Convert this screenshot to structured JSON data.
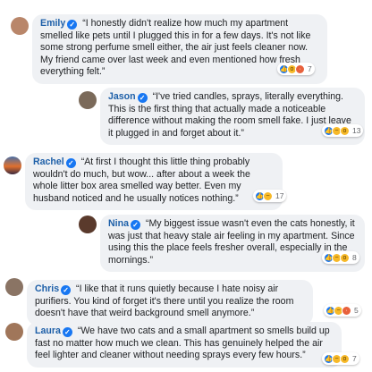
{
  "comments": [
    {
      "author": "Emily",
      "text": "“I honestly didn't realize how much my apartment smelled like pets until I plugged this in for a few days. It's not like some strong perfume smell either, the air just feels cleaner now. My friend came over last week and even mentioned how fresh everything felt.”",
      "reaction_count": "7",
      "reactions": [
        "like-icon",
        "wow-icon",
        "angry-icon"
      ],
      "avatar_color": "#b9866a"
    },
    {
      "author": "Jason",
      "text": "“I've tried candles, sprays, literally everything. This is the first thing that actually made a noticeable difference without making the room smell fake. I just leave it plugged in and forget about it.”",
      "reaction_count": "13",
      "reactions": [
        "like-icon",
        "haha-icon",
        "wow-icon"
      ],
      "avatar_color": "#7b6a5a"
    },
    {
      "author": "Rachel",
      "text": "“At first I thought this little thing probably wouldn't do much, but wow... after about a week the whole litter box area smelled way better. Even my husband noticed and he usually notices nothing.”",
      "reaction_count": "17",
      "reactions": [
        "like-icon",
        "haha-icon"
      ],
      "avatar_color": "#e0702e"
    },
    {
      "author": "Nina",
      "text": "“My biggest issue wasn't even the cats honestly, it was just that heavy stale air feeling in my apartment. Since using this the place feels fresher overall, especially in the mornings.”",
      "reaction_count": "8",
      "reactions": [
        "like-icon",
        "haha-icon",
        "wow-icon"
      ],
      "avatar_color": "#5a3a2c"
    },
    {
      "author": "Chris",
      "text": "“I like that it runs quietly because I hate noisy air purifiers. You kind of forget it's there until you realize the room doesn't have that weird background smell anymore.”",
      "reaction_count": "5",
      "reactions": [
        "like-icon",
        "haha-icon",
        "angry-icon"
      ],
      "avatar_color": "#8a7464"
    },
    {
      "author": "Laura",
      "text": "“We have two cats and a small apartment so  smells build up fast no matter how much we clean. This has genuinely helped the air feel lighter and cleaner without needing sprays every few hours.”",
      "reaction_count": "7",
      "reactions": [
        "like-icon",
        "haha-icon",
        "wow-icon"
      ],
      "avatar_color": "#a0765a"
    }
  ]
}
